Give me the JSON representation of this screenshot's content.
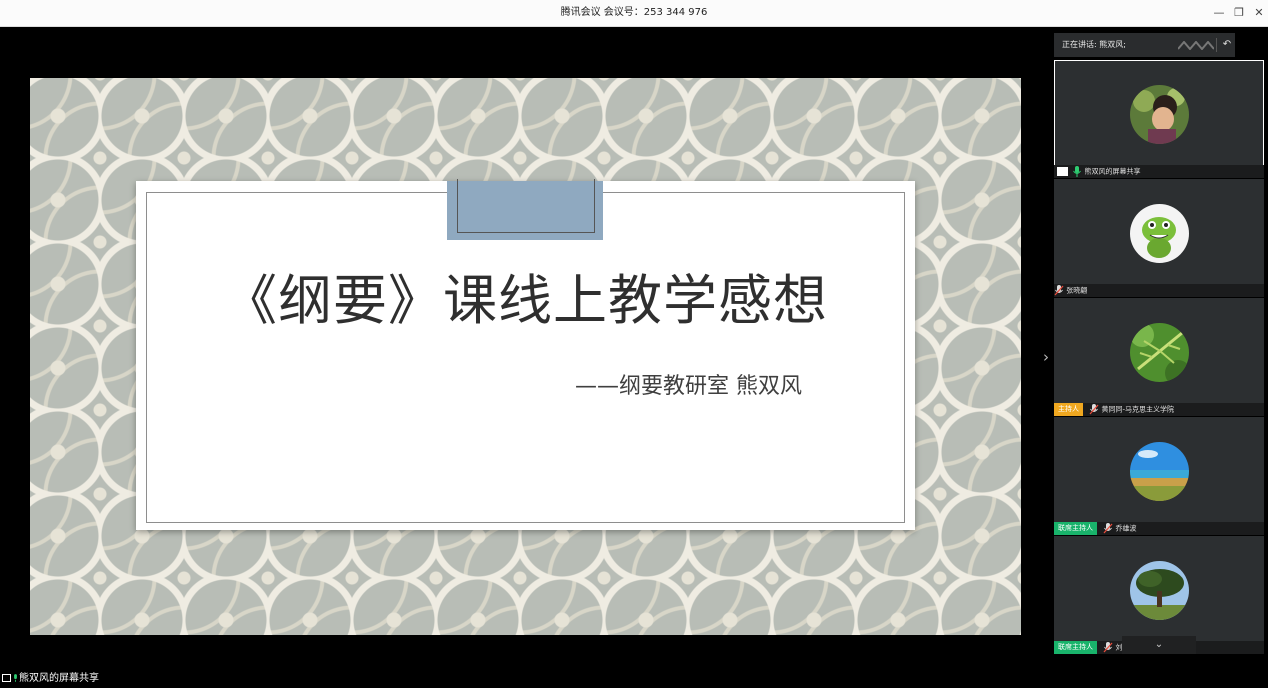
{
  "window": {
    "title": "腾讯会议 会议号：253 344 976",
    "minimize_icon": "minimize-icon",
    "restore_icon": "restore-icon",
    "close_icon": "close-icon",
    "minimize_glyph": "—",
    "restore_glyph": "❐",
    "close_glyph": "✕"
  },
  "slide": {
    "title": "《纲要》课线上教学感想",
    "subtitle": "——纲要教研室  熊双风",
    "colors": {
      "pattern_bg": "#b8bdb6",
      "tab": "#8fa9c0",
      "card": "#ffffff"
    }
  },
  "panel": {
    "speaking_label": "正在讲话: 熊双风;",
    "collapse_glyph": "›",
    "reply_glyph": "↶",
    "participants": [
      {
        "name": "熊双风的屏幕共享",
        "role": "",
        "mic": "on",
        "screen_share": true
      },
      {
        "name": "张晓翩",
        "role": "",
        "mic": "off",
        "screen_share": false
      },
      {
        "name": "黄同同-马克思主义学院",
        "role": "主持人",
        "mic": "off",
        "screen_share": false
      },
      {
        "name": "乔雄波",
        "role": "联席主持人",
        "mic": "off",
        "screen_share": false
      },
      {
        "name": "刘相培",
        "role": "联席主持人",
        "mic": "off",
        "screen_share": false
      }
    ],
    "colors": {
      "host_tag": "#f0a820",
      "cohost_tag": "#19b36b",
      "mic_on": "#2ecc71",
      "mic_off": "#e74c3c"
    },
    "more_glyph": "⌄"
  },
  "status": {
    "sharing_text": "熊双风的屏幕共享"
  }
}
